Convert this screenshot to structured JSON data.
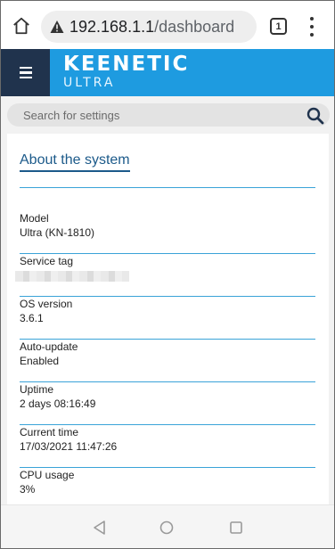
{
  "browser": {
    "url_host": "192.168.1.1",
    "url_path": "/dashboard",
    "tab_count": "1"
  },
  "header": {
    "logo_main": "KEENETIC",
    "logo_sub": "ULTRA",
    "accent_color": "#1e9be0",
    "menu_bg": "#20334d"
  },
  "search": {
    "placeholder": "Search for settings"
  },
  "card": {
    "title": "About the system",
    "items": [
      {
        "label": "Model",
        "value": "Ultra (KN-1810)"
      },
      {
        "label": "Service tag",
        "value": ""
      },
      {
        "label": "OS version",
        "value": "3.6.1"
      },
      {
        "label": "Auto-update",
        "value": "Enabled"
      },
      {
        "label": "Uptime",
        "value": "2 days 08:16:49"
      },
      {
        "label": "Current time",
        "value": "17/03/2021 11:47:26"
      },
      {
        "label": "CPU usage",
        "value": "3%"
      }
    ]
  },
  "icons": {
    "home": "home-icon",
    "warning": "warning-icon",
    "menu": "more-vert-icon",
    "hamburger": "hamburger-icon",
    "search": "search-icon",
    "back": "back-icon",
    "home_nav": "home-circle-icon",
    "recents": "recents-icon"
  }
}
